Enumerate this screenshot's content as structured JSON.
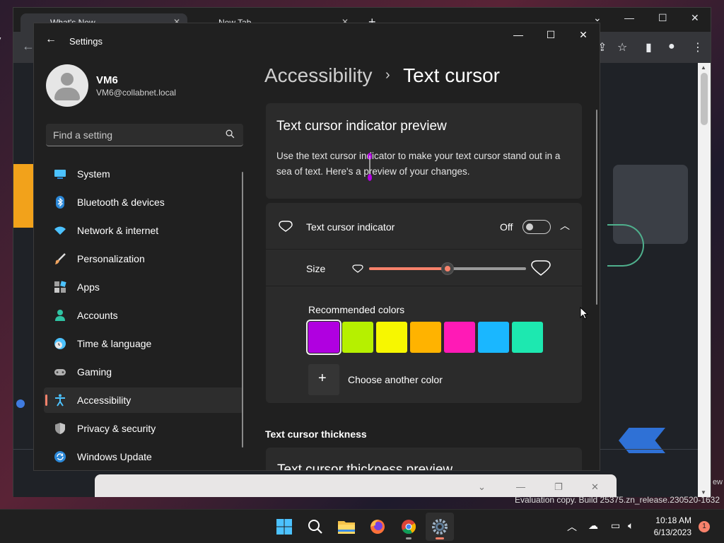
{
  "browser": {
    "tabs": [
      {
        "label": "What's New"
      },
      {
        "label": "New Tab"
      }
    ],
    "new_tab_glyph": "+",
    "left_edge_text": "My",
    "right_edge_text": "ew",
    "bottom_panel_glyphs": [
      "⌄",
      "—",
      "❐",
      "✕"
    ]
  },
  "settings": {
    "window_title": "Settings",
    "user": {
      "name": "VM6",
      "email": "VM6@collabnet.local"
    },
    "search": {
      "placeholder": "Find a setting"
    },
    "nav": [
      {
        "label": "System",
        "icon": "system-icon",
        "color": "#4cc2ff"
      },
      {
        "label": "Bluetooth & devices",
        "icon": "bluetooth-icon",
        "color": "#2b88d8"
      },
      {
        "label": "Network & internet",
        "icon": "wifi-icon",
        "color": "#4cc2ff"
      },
      {
        "label": "Personalization",
        "icon": "brush-icon",
        "color": "#f0a35e"
      },
      {
        "label": "Apps",
        "icon": "apps-icon",
        "color": "#a0a0a0"
      },
      {
        "label": "Accounts",
        "icon": "accounts-icon",
        "color": "#2fc3a3"
      },
      {
        "label": "Time & language",
        "icon": "globe-clock-icon",
        "color": "#4cc2ff"
      },
      {
        "label": "Gaming",
        "icon": "gamepad-icon",
        "color": "#b0b0b0"
      },
      {
        "label": "Accessibility",
        "icon": "accessibility-icon",
        "color": "#4cc2ff",
        "active": true
      },
      {
        "label": "Privacy & security",
        "icon": "shield-icon",
        "color": "#9a9a9a"
      },
      {
        "label": "Windows Update",
        "icon": "update-icon",
        "color": "#4cc2ff"
      }
    ],
    "breadcrumb": {
      "parent": "Accessibility",
      "separator": "›",
      "current": "Text cursor"
    },
    "preview_card": {
      "title": "Text cursor indicator preview",
      "description": "Use the text cursor indicator to make your text cursor stand out in a sea of text. Here's a preview of your changes."
    },
    "indicator": {
      "label": "Text cursor indicator",
      "state": "Off",
      "enabled": false
    },
    "size": {
      "label": "Size",
      "level_percent": 50
    },
    "colors": {
      "label": "Recommended colors",
      "swatches": [
        "#b000e0",
        "#b6f000",
        "#f7f700",
        "#ffb300",
        "#ff1ab6",
        "#1ab7ff",
        "#1de8b0"
      ],
      "selected_index": 0,
      "choose_label": "Choose another color"
    },
    "thickness": {
      "heading": "Text cursor thickness",
      "card_title": "Text cursor thickness preview"
    },
    "accent_color": "#f7826b"
  },
  "taskbar": {
    "apps": [
      "windows-start-icon",
      "search-icon",
      "file-explorer-icon",
      "firefox-icon",
      "chrome-icon",
      "settings-icon"
    ],
    "time": "10:18 AM",
    "date": "6/13/2023",
    "notification_count": "1"
  },
  "watermark": "Evaluation copy. Build 25375.zn_release.230520-1632"
}
